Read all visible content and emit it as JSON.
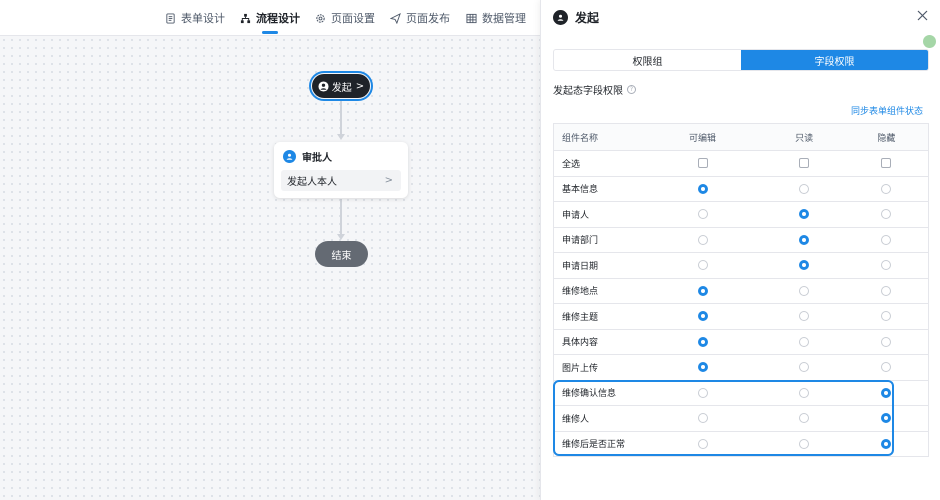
{
  "nav": {
    "tabs": [
      {
        "label": "表单设计",
        "icon": "document-icon"
      },
      {
        "label": "流程设计",
        "icon": "flow-icon",
        "active": true
      },
      {
        "label": "页面设置",
        "icon": "gear-icon"
      },
      {
        "label": "页面发布",
        "icon": "send-icon"
      },
      {
        "label": "数据管理",
        "icon": "grid-icon"
      }
    ]
  },
  "flow": {
    "start_label": "发起",
    "start_chevron": ">",
    "approver_title": "审批人",
    "approver_value": "发起人本人",
    "approver_chevron": ">",
    "end_label": "结束"
  },
  "panel": {
    "title": "发起",
    "segments": [
      "权限组",
      "字段权限"
    ],
    "active_segment": 1,
    "section_title": "发起态字段权限",
    "help_icon": "?",
    "sync_link": "同步表单组件状态",
    "columns": [
      "组件名称",
      "可编辑",
      "只读",
      "隐藏"
    ],
    "select_all_label": "全选",
    "rows": [
      {
        "name": "基本信息",
        "selected": "edit"
      },
      {
        "name": "申请人",
        "selected": "read"
      },
      {
        "name": "申请部门",
        "selected": "read"
      },
      {
        "name": "申请日期",
        "selected": "read"
      },
      {
        "name": "维修地点",
        "selected": "edit"
      },
      {
        "name": "维修主题",
        "selected": "edit"
      },
      {
        "name": "具体内容",
        "selected": "edit"
      },
      {
        "name": "图片上传",
        "selected": "edit"
      },
      {
        "name": "维修确认信息",
        "selected": "hide"
      },
      {
        "name": "维修人",
        "selected": "hide"
      },
      {
        "name": "维修后是否正常",
        "selected": "hide"
      }
    ]
  },
  "colors": {
    "accent": "#1e88e5",
    "dark": "#1f2329",
    "end_node": "#646a73"
  }
}
